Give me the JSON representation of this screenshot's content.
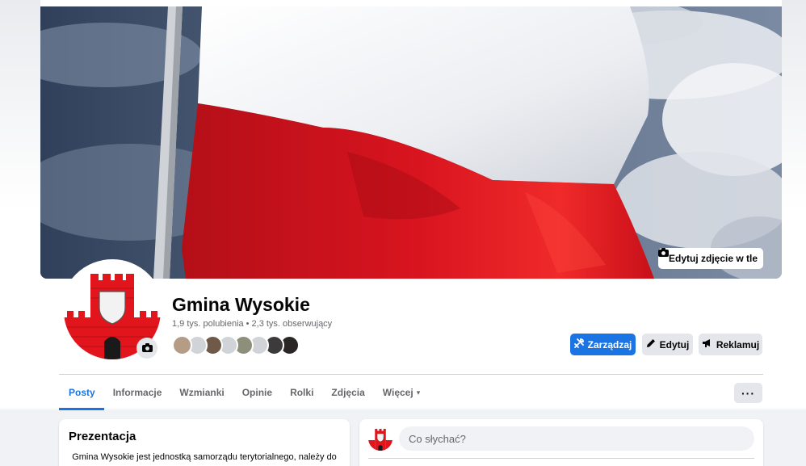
{
  "cover": {
    "edit_cover_label": "Edytuj zdjęcie w tle"
  },
  "page": {
    "name": "Gmina Wysokie",
    "likes": "1,9 tys. polubienia",
    "separator": "•",
    "followers": "2,3 tys. obserwujący"
  },
  "actions": {
    "manage_label": "Zarządzaj",
    "edit_label": "Edytuj",
    "advertise_label": "Reklamuj"
  },
  "tabs": [
    {
      "label": "Posty",
      "active": true
    },
    {
      "label": "Informacje",
      "active": false
    },
    {
      "label": "Wzmianki",
      "active": false
    },
    {
      "label": "Opinie",
      "active": false
    },
    {
      "label": "Rolki",
      "active": false
    },
    {
      "label": "Zdjęcia",
      "active": false
    },
    {
      "label": "Więcej",
      "active": false
    }
  ],
  "more_tab_caret": "▾",
  "more_options_label": "···",
  "intro": {
    "title": "Prezentacja",
    "text": "Gmina Wysokie jest jednostką samorządu terytorialnego, należy do"
  },
  "composer": {
    "placeholder": "Co słychać?"
  },
  "friend_avatar_colors": [
    "#b59c86",
    "#d0d3d8",
    "#6f5a4a",
    "#d0d3d8",
    "#8d8f7a",
    "#d0d3d8",
    "#3c3a3a",
    "#2a2626"
  ],
  "colors": {
    "accent": "#1b74e4",
    "flag_white": "#f4f4f6",
    "flag_red": "#d4121e",
    "coat_red": "#e2141c"
  },
  "icons": {
    "camera": "camera-icon",
    "manage": "tools-icon",
    "edit": "pencil-icon",
    "advertise": "megaphone-icon"
  }
}
